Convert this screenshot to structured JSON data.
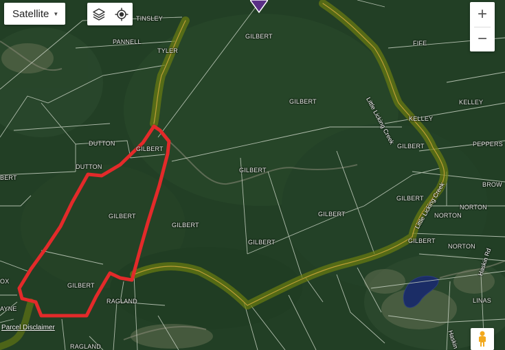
{
  "map_type_selector": {
    "label": "Satellite"
  },
  "zoom": {
    "in_label": "+",
    "out_label": "−"
  },
  "disclaimer": "Parcel Disclaimer",
  "colors": {
    "boundary_red": "#e32a2a",
    "creek_buffer": "#6b7d10",
    "parcel_lines": "#c9d3c4",
    "pond": "#1b2d66"
  },
  "parcel_labels": [
    "TINSLEY",
    "PANNELL",
    "TYLER",
    "GILBERT",
    "FIFE",
    "GILBERT",
    "KELLEY",
    "DUTTON",
    "GILBERT",
    "DUTTON",
    "GILBERT",
    "BERT",
    "GILBERT",
    "GILBERT",
    "GILBERT",
    "GILBERT",
    "PEPPERS",
    "BROW",
    "GILBERT",
    "NORTON",
    "NORTON",
    "GILBERT",
    "NORTON",
    "GILBERT",
    "OX",
    "GILBERT",
    "RAGLAND",
    "AYNE",
    "LINAS",
    "RAGLAND",
    "KELLEY"
  ],
  "road_labels": [
    "Little Licking Creek",
    "Little Licking Creek",
    "Haskin Rd",
    "Haskin"
  ]
}
